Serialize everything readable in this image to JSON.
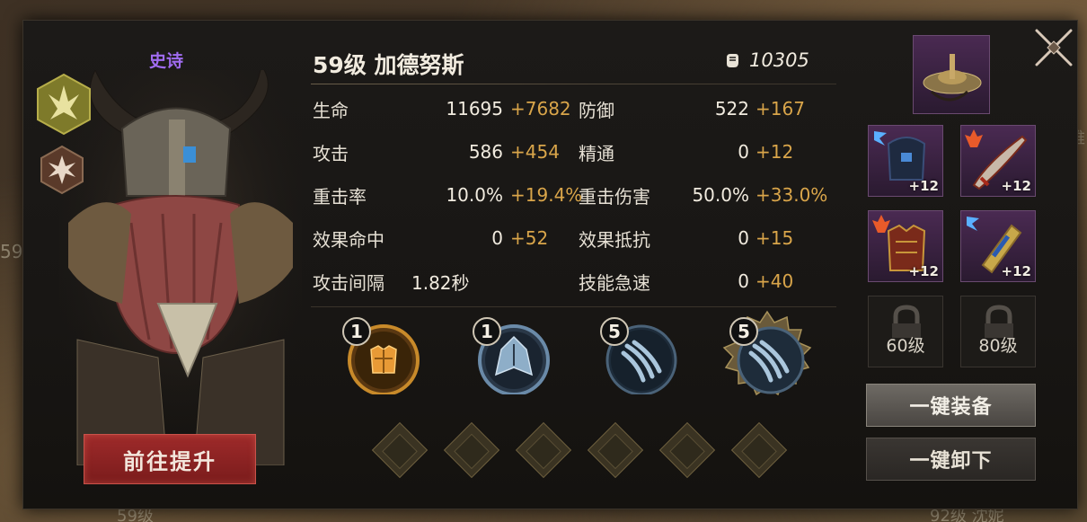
{
  "background": {
    "left_edge_number": "59",
    "bottom_left_level": "59级",
    "bottom_right_text": "92级 沈妮",
    "right_edge_char": "维"
  },
  "hero": {
    "rarity": "史诗",
    "title": "59级 加德努斯",
    "power_value": "10305",
    "upgrade_button": "前往提升"
  },
  "stats": {
    "left": [
      {
        "label": "生命",
        "base": "11695",
        "bonus": "+7682"
      },
      {
        "label": "攻击",
        "base": "586",
        "bonus": "+454"
      },
      {
        "label": "重击率",
        "base": "10.0%",
        "bonus": "+19.4%"
      },
      {
        "label": "效果命中",
        "base": "0",
        "bonus": "+52"
      },
      {
        "label": "攻击间隔",
        "base": "1.82秒",
        "bonus": ""
      }
    ],
    "right": [
      {
        "label": "防御",
        "base": "522",
        "bonus": "+167"
      },
      {
        "label": "精通",
        "base": "0",
        "bonus": "+12"
      },
      {
        "label": "重击伤害",
        "base": "50.0%",
        "bonus": "+33.0%"
      },
      {
        "label": "效果抵抗",
        "base": "0",
        "bonus": "+15"
      },
      {
        "label": "技能急速",
        "base": "0",
        "bonus": "+40"
      }
    ]
  },
  "skills": [
    {
      "level": "1",
      "icon": "armor-skill-icon"
    },
    {
      "level": "1",
      "icon": "cloak-skill-icon"
    },
    {
      "level": "5",
      "icon": "claw-slash-skill-icon"
    },
    {
      "level": "5",
      "icon": "claw-burst-skill-icon"
    }
  ],
  "equipment": {
    "accessory": {
      "icon": "saucer-accessory-icon"
    },
    "items": [
      {
        "icon": "helmet-icon",
        "plus": "+12"
      },
      {
        "icon": "sword-icon",
        "plus": "+12"
      },
      {
        "icon": "chest-armor-icon",
        "plus": "+12"
      },
      {
        "icon": "bracer-icon",
        "plus": "+12"
      }
    ],
    "locked": [
      {
        "level": "60级"
      },
      {
        "level": "80级"
      }
    ],
    "equip_all_button": "一键装备",
    "unequip_all_button": "一键卸下"
  },
  "colors": {
    "rarity": "#a06cf0",
    "bonus": "#d9a54a",
    "upgrade": "#8a2424"
  }
}
